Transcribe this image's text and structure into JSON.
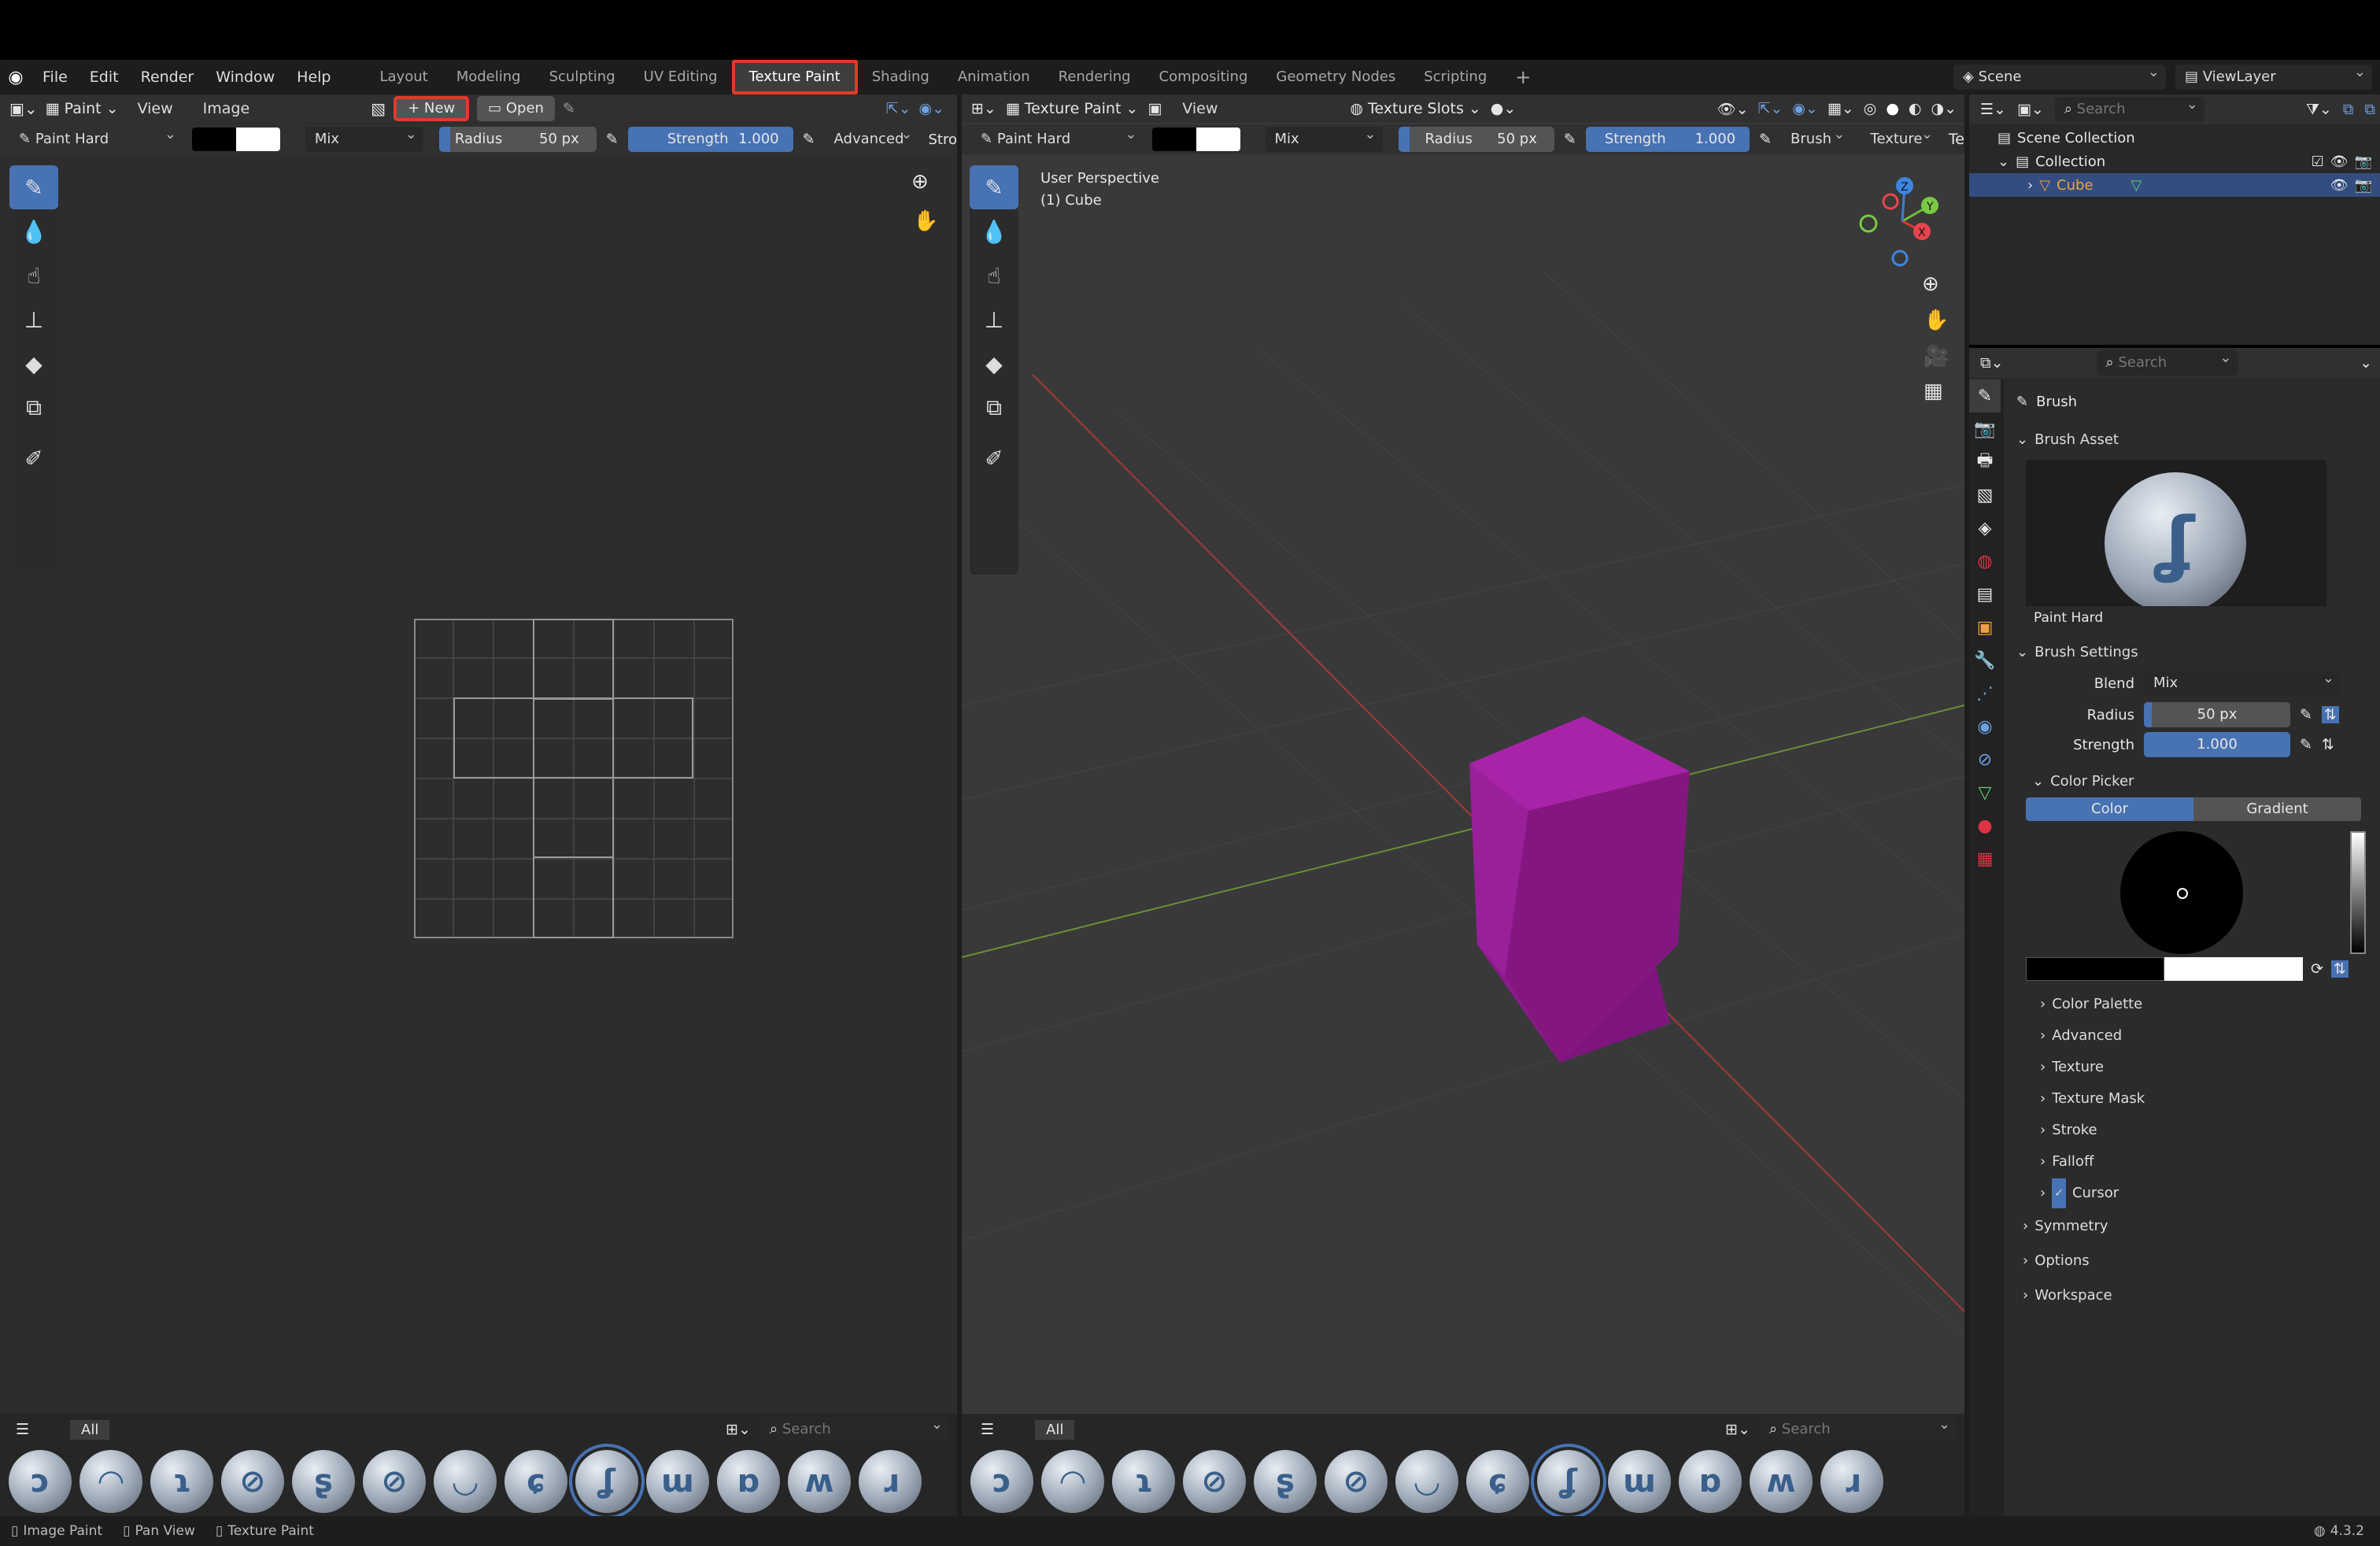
{
  "topbar": {
    "menus": [
      "File",
      "Edit",
      "Render",
      "Window",
      "Help"
    ],
    "workspaces": [
      "Layout",
      "Modeling",
      "Sculpting",
      "UV Editing",
      "Texture Paint",
      "Shading",
      "Animation",
      "Rendering",
      "Compositing",
      "Geometry Nodes",
      "Scripting"
    ],
    "active_workspace": "Texture Paint",
    "add_tab": "+",
    "scene": "Scene",
    "view_layer": "ViewLayer"
  },
  "image_editor": {
    "mode": "Paint",
    "menus": [
      "View",
      "Image"
    ],
    "new_label": "New",
    "open_label": "Open",
    "brush": "Paint Hard",
    "blend": "Mix",
    "radius_label": "Radius",
    "radius_value": "50 px",
    "strength_label": "Strength",
    "strength_value": "1.000",
    "advanced": "Advanced",
    "truncated": "Stro",
    "asset_filter": "All",
    "search_placeholder": "Search"
  },
  "viewport": {
    "mode": "Texture Paint",
    "menu": "View",
    "texture_slots": "Texture Slots",
    "brush": "Paint Hard",
    "blend": "Mix",
    "radius_label": "Radius",
    "radius_value": "50 px",
    "strength_label": "Strength",
    "strength_value": "1.000",
    "brush_menu": "Brush",
    "texture_menu": "Texture",
    "truncated": "Te",
    "perspective": "User Perspective",
    "object": "(1) Cube",
    "asset_filter": "All",
    "search_placeholder": "Search",
    "cube_color": "#8e1a8e",
    "gizmo": {
      "x": "X",
      "y": "Y",
      "z": "Z"
    }
  },
  "outliner": {
    "search_placeholder": "Search",
    "scene_collection": "Scene Collection",
    "collection": "Collection",
    "cube": "Cube"
  },
  "properties": {
    "search_placeholder": "Search",
    "context": "Brush",
    "brush_asset": "Brush Asset",
    "brush_name": "Paint Hard",
    "brush_settings": "Brush Settings",
    "blend_label": "Blend",
    "blend_value": "Mix",
    "radius_label": "Radius",
    "radius_value": "50 px",
    "strength_label": "Strength",
    "strength_value": "1.000",
    "color_picker": "Color Picker",
    "color_tab": "Color",
    "gradient_tab": "Gradient",
    "subpanels": [
      "Color Palette",
      "Advanced",
      "Texture",
      "Texture Mask",
      "Stroke",
      "Falloff",
      "Cursor"
    ],
    "panels": [
      "Symmetry",
      "Options",
      "Workspace"
    ]
  },
  "statusbar": {
    "items": [
      "Image Paint",
      "Pan View",
      "Texture Paint"
    ],
    "version": "4.3.2"
  },
  "colors": {
    "accent": "#4772b3",
    "highlight_box": "#e2392b",
    "background": "#393939"
  }
}
